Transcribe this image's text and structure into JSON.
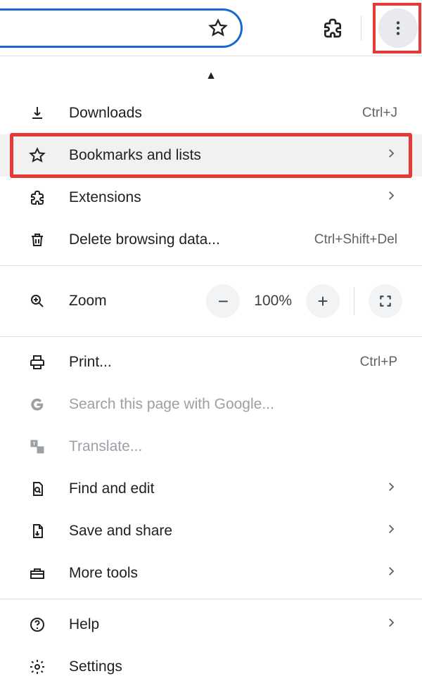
{
  "toolbar": {
    "bookmark_star": "star-icon",
    "extensions": "puzzle-icon",
    "menu": "three-dots-icon"
  },
  "menu": {
    "triangle": "▲",
    "items": [
      {
        "id": "downloads",
        "label": "Downloads",
        "accel": "Ctrl+J",
        "submenu": false
      },
      {
        "id": "bookmarks",
        "label": "Bookmarks and lists",
        "accel": "",
        "submenu": true
      },
      {
        "id": "extensions",
        "label": "Extensions",
        "accel": "",
        "submenu": true
      },
      {
        "id": "deletedata",
        "label": "Delete browsing data...",
        "accel": "Ctrl+Shift+Del",
        "submenu": false
      }
    ],
    "zoom": {
      "label": "Zoom",
      "value": "100%"
    },
    "items2": [
      {
        "id": "print",
        "label": "Print...",
        "accel": "Ctrl+P",
        "submenu": false,
        "muted": false
      },
      {
        "id": "searchpage",
        "label": "Search this page with Google...",
        "accel": "",
        "submenu": false,
        "muted": true
      },
      {
        "id": "translate",
        "label": "Translate...",
        "accel": "",
        "submenu": false,
        "muted": true
      },
      {
        "id": "findedit",
        "label": "Find and edit",
        "accel": "",
        "submenu": true,
        "muted": false
      },
      {
        "id": "saveshare",
        "label": "Save and share",
        "accel": "",
        "submenu": true,
        "muted": false
      },
      {
        "id": "moretools",
        "label": "More tools",
        "accel": "",
        "submenu": true,
        "muted": false
      }
    ],
    "items3": [
      {
        "id": "help",
        "label": "Help",
        "accel": "",
        "submenu": true
      },
      {
        "id": "settings",
        "label": "Settings",
        "accel": "",
        "submenu": false
      }
    ]
  }
}
